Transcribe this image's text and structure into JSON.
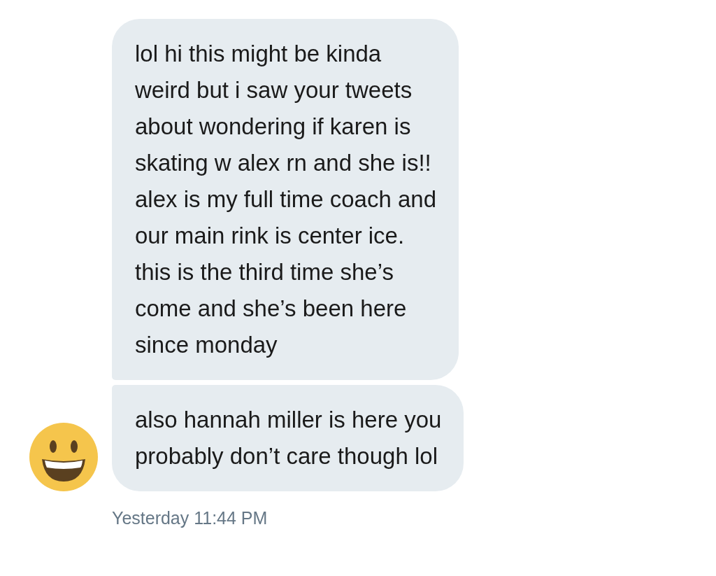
{
  "messages": [
    {
      "text": "lol hi this might be kinda\nweird but i saw your tweets\nabout wondering if karen is\nskating w alex rn and she is!!\nalex is my full time coach and\nour main rink is center ice.\nthis is the third time she’s\ncome and she’s been here\nsince monday"
    },
    {
      "text": "also hannah miller is here you\nprobably don’t care though lol"
    }
  ],
  "timestamp": "Yesterday 11:44 PM"
}
